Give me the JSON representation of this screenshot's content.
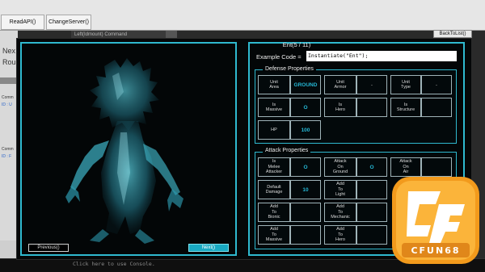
{
  "toolbar": {
    "read_api": "ReadAPI()",
    "change_server": "ChangeServer()"
  },
  "background": {
    "header_text": "Left(Idmount) Command",
    "next_label": "Nex",
    "round_label": "Rou",
    "comment_1": "Comm",
    "id_1": "ID : U",
    "comment_2": "Comm",
    "id_2": "ID : F",
    "console_hint": "Click here to use Console."
  },
  "modal": {
    "back_button": "BackToList()",
    "previous_button": "Previous()",
    "next_button": "Next()",
    "entity_title": "Ent(5 / 11)",
    "code_label": "Example Code =",
    "code_value": "Instantiate(\"Ent\");"
  },
  "defense": {
    "title": "Defense Properties",
    "rows": [
      [
        {
          "label": "Unit\nArea",
          "value": "GROUND"
        },
        {
          "label": "Unit\nArmor",
          "value": "-"
        },
        {
          "label": "Unit\nType",
          "value": "-"
        }
      ],
      [
        {
          "label": "Is\nMassive",
          "value": "O"
        },
        {
          "label": "Is\nHero",
          "value": ""
        },
        {
          "label": "Is\nStructure",
          "value": ""
        }
      ],
      [
        {
          "label": "HP",
          "value": "100"
        }
      ]
    ]
  },
  "attack": {
    "title": "Attack Properties",
    "rows": [
      [
        {
          "label": "Is\nMelee\nAttacker",
          "value": "O"
        },
        {
          "label": "Attack\nOn\nGround",
          "value": "O"
        },
        {
          "label": "Attack\nOn\nAir",
          "value": ""
        }
      ],
      [
        {
          "label": "Default\nDamage",
          "value": "10"
        },
        {
          "label": "Add\nTo\nLight",
          "value": ""
        }
      ],
      [
        {
          "label": "Add\nTo\nBionic",
          "value": ""
        },
        {
          "label": "Add\nTo\nMechanic",
          "value": ""
        }
      ],
      [
        {
          "label": "Add\nTo\nMassive",
          "value": ""
        },
        {
          "label": "Add\nTo\nHero",
          "value": ""
        }
      ]
    ]
  },
  "logo": {
    "brand": "CF",
    "text": "CFUN68"
  },
  "colors": {
    "accent": "#2fb9cf",
    "value_text": "#25b8d6",
    "logo_orange": "#f29a1c"
  }
}
